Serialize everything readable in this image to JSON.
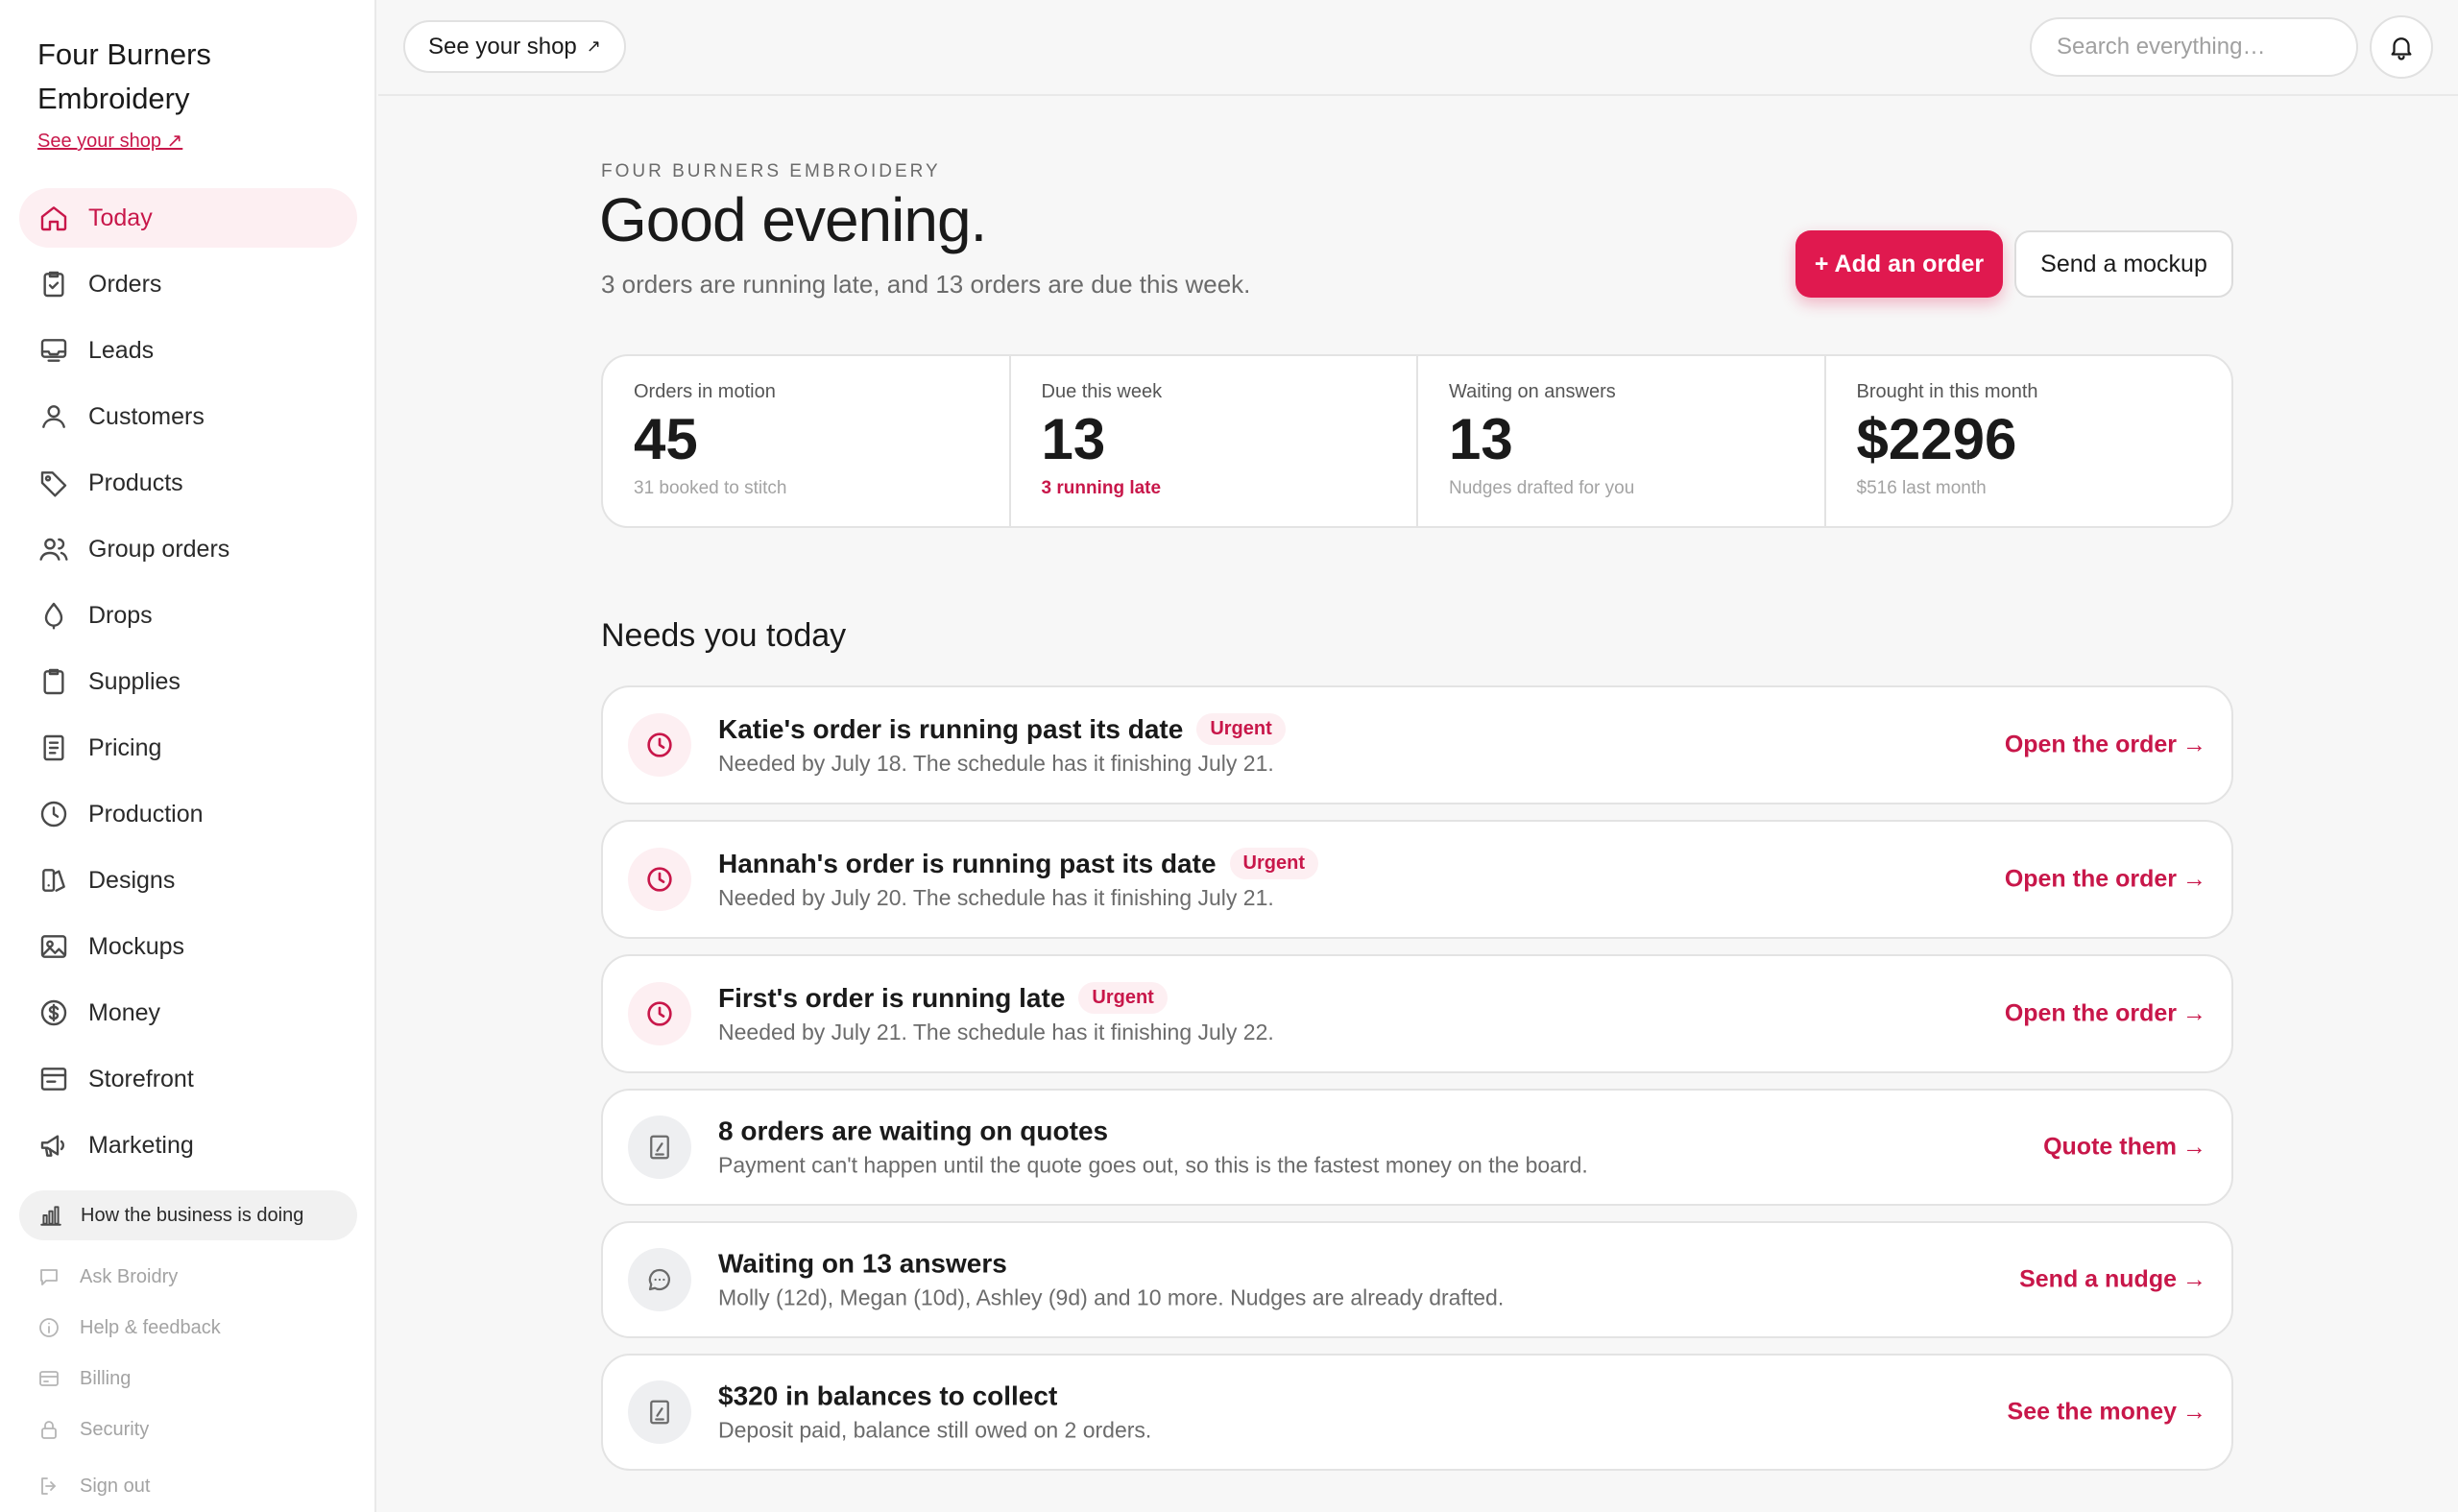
{
  "sidebar": {
    "brand": "Four Burners Embroidery",
    "shop_link": "See your shop ↗",
    "nav": [
      {
        "label": "Today",
        "icon": "home-icon",
        "active": true
      },
      {
        "label": "Orders",
        "icon": "clipboard-check-icon"
      },
      {
        "label": "Leads",
        "icon": "inbox-icon"
      },
      {
        "label": "Customers",
        "icon": "user-icon"
      },
      {
        "label": "Products",
        "icon": "tag-icon"
      },
      {
        "label": "Group orders",
        "icon": "users-icon"
      },
      {
        "label": "Drops",
        "icon": "drop-icon"
      },
      {
        "label": "Supplies",
        "icon": "clipboard-icon"
      },
      {
        "label": "Pricing",
        "icon": "receipt-icon"
      },
      {
        "label": "Production",
        "icon": "clock-icon"
      },
      {
        "label": "Designs",
        "icon": "designs-icon"
      },
      {
        "label": "Mockups",
        "icon": "image-icon"
      },
      {
        "label": "Money",
        "icon": "dollar-icon"
      },
      {
        "label": "Storefront",
        "icon": "storefront-icon"
      },
      {
        "label": "Marketing",
        "icon": "megaphone-icon"
      }
    ],
    "business_pill": "How the business is doing",
    "utility": [
      {
        "label": "Ask Broidry",
        "icon": "chat-icon"
      },
      {
        "label": "Help & feedback",
        "icon": "info-icon"
      },
      {
        "label": "Billing",
        "icon": "card-icon"
      },
      {
        "label": "Security",
        "icon": "lock-icon"
      },
      {
        "label": "Sign out",
        "icon": "sign-out-icon"
      }
    ]
  },
  "topbar": {
    "shop_button": "See your shop",
    "shop_arrow": "↗",
    "search_placeholder": "Search everything…"
  },
  "header": {
    "eyebrow": "FOUR BURNERS EMBROIDERY",
    "greeting": "Good evening.",
    "subtitle": "3 orders are running late, and 13 orders are due this week.",
    "add_order": "+ Add an order",
    "send_mockup": "Send a mockup"
  },
  "stats": [
    {
      "label": "Orders in motion",
      "value": "45",
      "note": "31 booked to stitch"
    },
    {
      "label": "Due this week",
      "value": "13",
      "note": "3 running late"
    },
    {
      "label": "Waiting on answers",
      "value": "13",
      "note": "Nudges drafted for you"
    },
    {
      "label": "Brought in this month",
      "value": "$2296",
      "note": "$516 last month"
    }
  ],
  "needs_today": {
    "title": "Needs you today",
    "tasks": [
      {
        "title": "Katie's order is running past its date",
        "badge": "Urgent",
        "desc": "Needed by July 18. The schedule has it finishing July 21.",
        "action": "Open the order",
        "icon": "clock-icon"
      },
      {
        "title": "Hannah's order is running past its date",
        "badge": "Urgent",
        "desc": "Needed by July 20. The schedule has it finishing July 21.",
        "action": "Open the order",
        "icon": "clock-icon"
      },
      {
        "title": "First's order is running late",
        "badge": "Urgent",
        "desc": "Needed by July 21. The schedule has it finishing July 22.",
        "action": "Open the order",
        "icon": "clock-icon"
      },
      {
        "title": "8 orders are waiting on quotes",
        "desc": "Payment can't happen until the quote goes out, so this is the fastest money on the board.",
        "action": "Quote them",
        "icon": "quote-doc-icon"
      },
      {
        "title": "Waiting on 13 answers",
        "desc": "Molly (12d), Megan (10d), Ashley (9d) and 10 more. Nudges are already drafted.",
        "action": "Send a nudge",
        "icon": "chat-icon"
      },
      {
        "title": "$320 in balances to collect",
        "desc": "Deposit paid, balance still owed on 2 orders.",
        "action": "See the money",
        "icon": "quote-doc-icon"
      }
    ]
  },
  "colors": {
    "accent": "#e0194f",
    "accent_text": "#c8174a",
    "accent_soft": "#fdeff2"
  }
}
